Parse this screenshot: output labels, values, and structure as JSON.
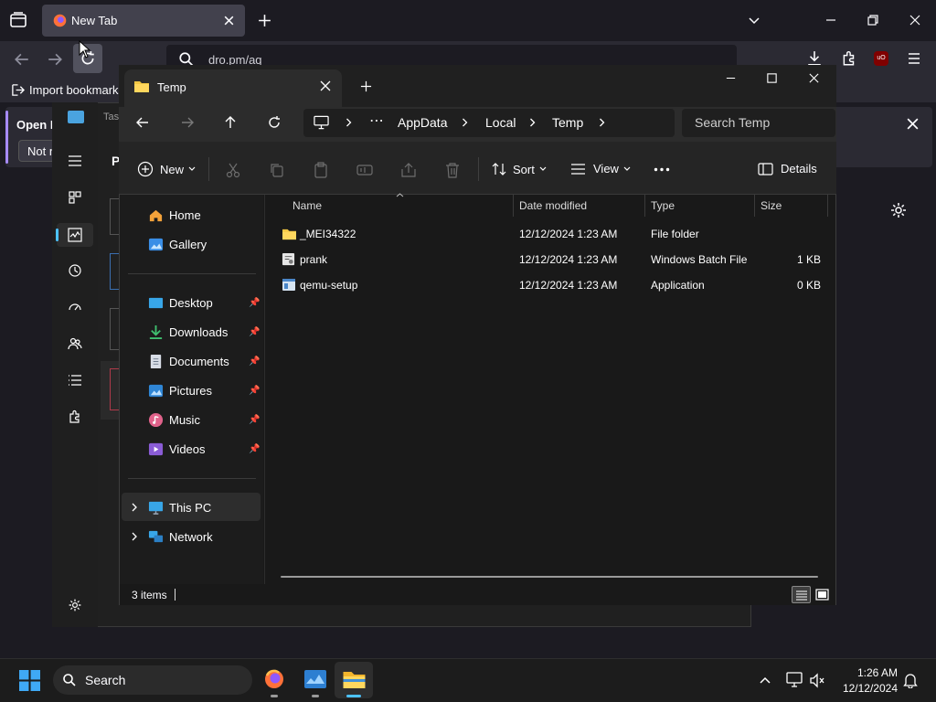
{
  "firefox": {
    "tab_title": "New Tab",
    "url_text": "dro.pm/aq",
    "bookmarks_item": "Import bookmarks",
    "banner_title": "Open F",
    "banner_sub": "Not n",
    "ublock_label": "uO"
  },
  "taskmgr": {
    "heading": "P",
    "title_fragment": "Tas"
  },
  "explorer": {
    "tab_title": "Temp",
    "breadcrumbs": [
      "AppData",
      "Local",
      "Temp"
    ],
    "search_placeholder": "Search Temp",
    "toolbar": {
      "new_label": "New",
      "sort_label": "Sort",
      "view_label": "View",
      "details_label": "Details"
    },
    "nav": {
      "home": "Home",
      "gallery": "Gallery",
      "pinned": [
        "Desktop",
        "Downloads",
        "Documents",
        "Pictures",
        "Music",
        "Videos"
      ],
      "this_pc": "This PC",
      "network": "Network"
    },
    "columns": [
      "Name",
      "Date modified",
      "Type",
      "Size"
    ],
    "files": [
      {
        "name": "_MEI34322",
        "date": "12/12/2024 1:23 AM",
        "type": "File folder",
        "size": ""
      },
      {
        "name": "prank",
        "date": "12/12/2024 1:23 AM",
        "type": "Windows Batch File",
        "size": "1 KB"
      },
      {
        "name": "qemu-setup",
        "date": "12/12/2024 1:23 AM",
        "type": "Application",
        "size": "0 KB"
      }
    ],
    "status": "3 items"
  },
  "taskbar": {
    "search_label": "Search",
    "time": "1:26 AM",
    "date": "12/12/2024"
  },
  "colors": {
    "accent": "#0067c0",
    "folder": "#f3c744",
    "firefox_orange": "#ff7139"
  }
}
